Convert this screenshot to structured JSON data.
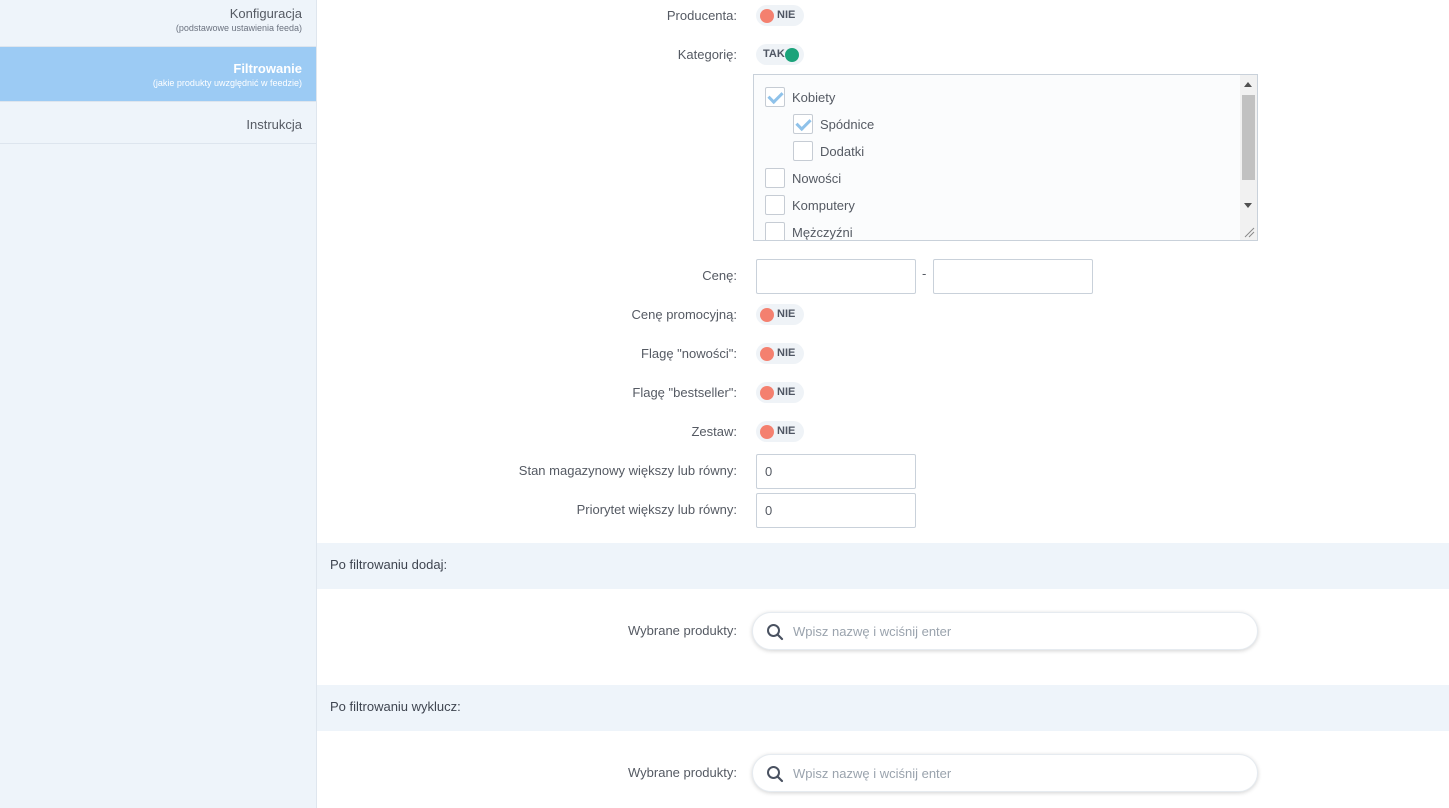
{
  "sidebar": {
    "items": [
      {
        "title": "Konfiguracja",
        "subtitle": "(podstawowe ustawienia feeda)"
      },
      {
        "title": "Filtrowanie",
        "subtitle": "(jakie produkty uwzględnić w feedzie)"
      },
      {
        "title": "Instrukcja"
      }
    ]
  },
  "filters": {
    "producer": {
      "label": "Producenta:",
      "value": "NIE"
    },
    "categories": {
      "label": "Kategorię:",
      "value": "TAK"
    },
    "category_tree": [
      {
        "label": "Kobiety",
        "checked": true
      },
      {
        "label": "Spódnice",
        "checked": true
      },
      {
        "label": "Dodatki",
        "checked": false
      },
      {
        "label": "Nowości",
        "checked": false
      },
      {
        "label": "Komputery",
        "checked": false
      },
      {
        "label": "Mężczyźni",
        "checked": false
      }
    ],
    "price": {
      "label": "Cenę:",
      "from": "",
      "separator": "-",
      "to": ""
    },
    "promo_price": {
      "label": "Cenę promocyjną:",
      "value": "NIE"
    },
    "flag_new": {
      "label": "Flagę \"nowości\":",
      "value": "NIE"
    },
    "flag_bestseller": {
      "label": "Flagę \"bestseller\":",
      "value": "NIE"
    },
    "bundle": {
      "label": "Zestaw:",
      "value": "NIE"
    },
    "stock": {
      "label": "Stan magazynowy większy lub równy:",
      "value": "0"
    },
    "priority": {
      "label": "Priorytet większy lub równy:",
      "value": "0"
    }
  },
  "add_section": {
    "title": "Po filtrowaniu dodaj:",
    "products_label": "Wybrane produkty:",
    "placeholder": "Wpisz nazwę i wciśnij enter"
  },
  "exclude_section": {
    "title": "Po filtrowaniu wyklucz:",
    "products_label": "Wybrane produkty:",
    "placeholder": "Wpisz nazwę i wciśnij enter"
  },
  "colors": {
    "toggle_off": "#f4806f",
    "toggle_on": "#1ba37a",
    "sidebar_active": "#9ccbf4",
    "section_bg": "#eef4fa"
  }
}
